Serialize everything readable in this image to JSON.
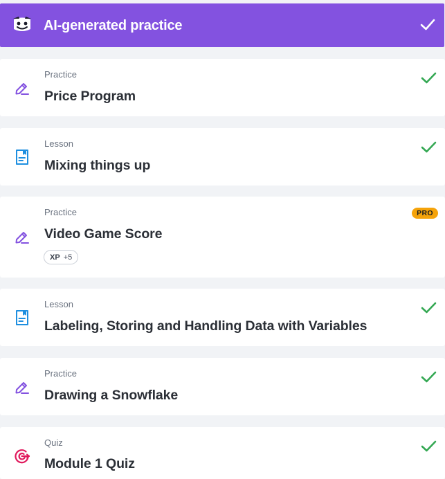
{
  "header": {
    "title": "AI-generated practice",
    "accent": "#8352e0",
    "mascot_icon": "ai-mascot-icon",
    "status_icon": "check-icon"
  },
  "items": [
    {
      "type": "Practice",
      "title": "Price Program",
      "icon": "pencil-practice-icon",
      "status": "completed"
    },
    {
      "type": "Lesson",
      "title": "Mixing things up",
      "icon": "lesson-document-icon",
      "status": "completed"
    },
    {
      "type": "Practice",
      "title": "Video Game Score",
      "icon": "pencil-practice-icon",
      "status": "locked-pro",
      "badge": "PRO",
      "xp_label": "XP",
      "xp_value": "+5"
    },
    {
      "type": "Lesson",
      "title": "Labeling, Storing and Handling Data with Variables",
      "icon": "lesson-document-icon",
      "status": "completed"
    },
    {
      "type": "Practice",
      "title": "Drawing a Snowflake",
      "icon": "pencil-practice-icon",
      "status": "completed"
    },
    {
      "type": "Quiz",
      "title": "Module 1 Quiz",
      "icon": "quiz-target-icon",
      "status": "completed"
    }
  ],
  "colors": {
    "check_green": "#34a853",
    "practice_purple": "#8352e0",
    "lesson_blue": "#1e8fe0",
    "quiz_pink": "#e0195c",
    "pro_badge": "#f5a30a"
  }
}
